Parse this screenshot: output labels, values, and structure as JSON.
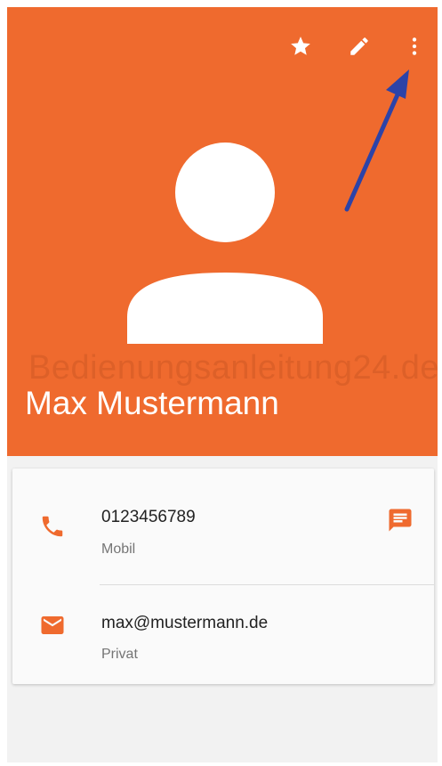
{
  "contact": {
    "name": "Max Mustermann",
    "watermark": "Bedienungsanleitung24.de",
    "phone": {
      "number": "0123456789",
      "type": "Mobil"
    },
    "email": {
      "address": "max@mustermann.de",
      "type": "Privat"
    }
  },
  "toolbar": {
    "icons": [
      "star-icon",
      "edit-pencil-icon",
      "more-vert-icon"
    ]
  },
  "colors": {
    "header": "#ef6a2e",
    "accent": "#ef6a2e",
    "annotation_arrow": "#2c43a8"
  }
}
